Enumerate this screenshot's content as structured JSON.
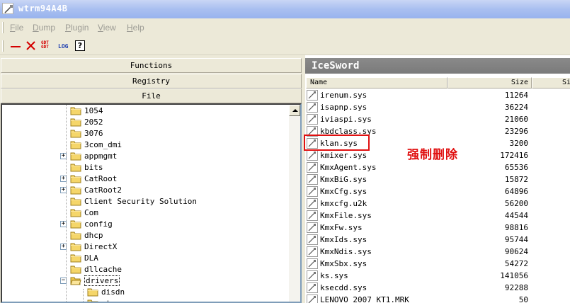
{
  "window": {
    "title": "wtrm94A4B"
  },
  "menu": [
    {
      "label": "File",
      "key": "F",
      "rest": "ile"
    },
    {
      "label": "Dump",
      "key": "D",
      "rest": "ump"
    },
    {
      "label": "Plugin",
      "key": "P",
      "rest": "lugin"
    },
    {
      "label": "View",
      "key": "V",
      "rest": "iew"
    },
    {
      "label": "Help",
      "key": "H",
      "rest": "elp"
    }
  ],
  "toolbar": {
    "gdt_label": "GDT",
    "log_label": "LOG",
    "help_label": "?"
  },
  "sections": {
    "functions": "Functions",
    "registry": "Registry",
    "file": "File"
  },
  "tree": [
    {
      "label": "1054",
      "expandable": false
    },
    {
      "label": "2052",
      "expandable": false
    },
    {
      "label": "3076",
      "expandable": false
    },
    {
      "label": "3com_dmi",
      "expandable": false
    },
    {
      "label": "appmgmt",
      "expandable": true
    },
    {
      "label": "bits",
      "expandable": false
    },
    {
      "label": "CatRoot",
      "expandable": true
    },
    {
      "label": "CatRoot2",
      "expandable": true
    },
    {
      "label": "Client Security Solution",
      "expandable": false
    },
    {
      "label": "Com",
      "expandable": false
    },
    {
      "label": "config",
      "expandable": true
    },
    {
      "label": "dhcp",
      "expandable": false
    },
    {
      "label": "DirectX",
      "expandable": true
    },
    {
      "label": "DLA",
      "expandable": false
    },
    {
      "label": "dllcache",
      "expandable": false
    },
    {
      "label": "drivers",
      "expandable": true,
      "expanded": true
    },
    {
      "label": "disdn",
      "expandable": false,
      "child": true
    },
    {
      "label": "etc",
      "expandable": false,
      "child": true
    }
  ],
  "right": {
    "brand": "IceSword",
    "columns": {
      "name": "Name",
      "size": "Size",
      "extra": "Si"
    }
  },
  "files": [
    {
      "name": "irenum.sys",
      "size": "11264"
    },
    {
      "name": "isapnp.sys",
      "size": "36224"
    },
    {
      "name": "iviaspi.sys",
      "size": "21060"
    },
    {
      "name": "kbdclass.sys",
      "size": "23296"
    },
    {
      "name": "klan.sys",
      "size": "3200"
    },
    {
      "name": "kmixer.sys",
      "size": "172416"
    },
    {
      "name": "KmxAgent.sys",
      "size": "65536"
    },
    {
      "name": "KmxBiG.sys",
      "size": "15872"
    },
    {
      "name": "KmxCfg.sys",
      "size": "64896"
    },
    {
      "name": "kmxcfg.u2k",
      "size": "56200"
    },
    {
      "name": "KmxFile.sys",
      "size": "44544"
    },
    {
      "name": "KmxFw.sys",
      "size": "98816"
    },
    {
      "name": "KmxIds.sys",
      "size": "95744"
    },
    {
      "name": "KmxNdis.sys",
      "size": "90624"
    },
    {
      "name": "KmxSbx.sys",
      "size": "54272"
    },
    {
      "name": "ks.sys",
      "size": "141056"
    },
    {
      "name": "ksecdd.sys",
      "size": "92288"
    },
    {
      "name": "LENOVO_2007_KT1.MRK",
      "size": "50"
    }
  ],
  "annotation": {
    "text": "强制删除",
    "color": "#e01010"
  },
  "colors": {
    "title_gradient": "#a9bff0",
    "folder": "#f5d66a",
    "accent_red": "#d40000"
  }
}
